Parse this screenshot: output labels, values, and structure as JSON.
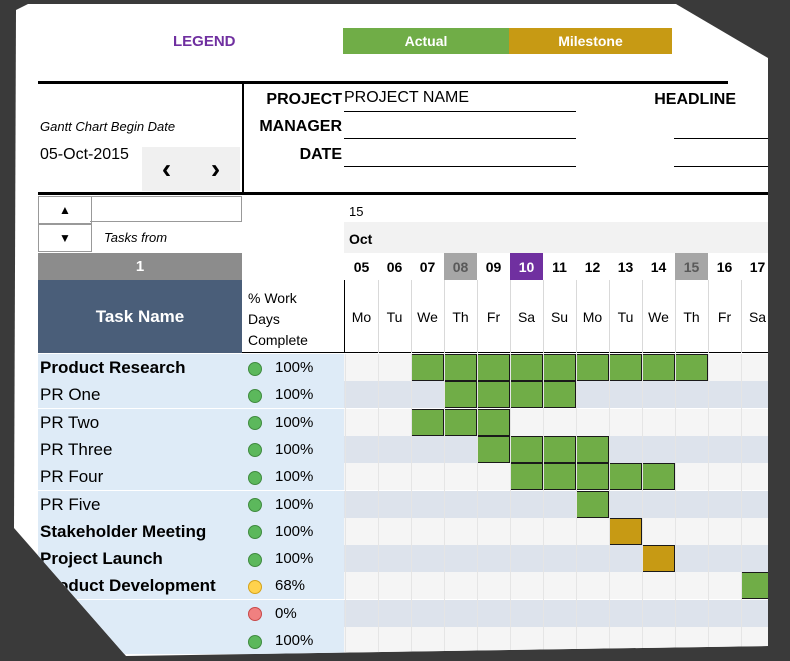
{
  "legend": {
    "title": "LEGEND",
    "actual": "Actual",
    "milestone": "Milestone"
  },
  "header": {
    "project_label": "PROJECT",
    "project_value": "PROJECT NAME",
    "manager_label": "MANAGER",
    "date_label": "DATE",
    "headline_label": "HEADLINE"
  },
  "begin": {
    "label": "Gantt Chart Begin Date",
    "date": "05-Oct-2015",
    "prev": "‹",
    "next": "›"
  },
  "scroll": {
    "up": "▲",
    "down": "▼",
    "tasks_from": "Tasks from",
    "start_index": "1"
  },
  "columns": {
    "task_name": "Task Name",
    "pct_line1": "% Work",
    "pct_line2": "Days",
    "pct_line3": "Complete"
  },
  "calendar": {
    "year": "15",
    "month": "Oct",
    "days": [
      {
        "num": "05",
        "name": "Mo",
        "type": "normal"
      },
      {
        "num": "06",
        "name": "Tu",
        "type": "normal"
      },
      {
        "num": "07",
        "name": "We",
        "type": "normal"
      },
      {
        "num": "08",
        "name": "Th",
        "type": "weekend"
      },
      {
        "num": "09",
        "name": "Fr",
        "type": "normal"
      },
      {
        "num": "10",
        "name": "Sa",
        "type": "today"
      },
      {
        "num": "11",
        "name": "Su",
        "type": "normal"
      },
      {
        "num": "12",
        "name": "Mo",
        "type": "normal"
      },
      {
        "num": "13",
        "name": "Tu",
        "type": "normal"
      },
      {
        "num": "14",
        "name": "We",
        "type": "normal"
      },
      {
        "num": "15",
        "name": "Th",
        "type": "weekend"
      },
      {
        "num": "16",
        "name": "Fr",
        "type": "normal"
      },
      {
        "num": "17",
        "name": "Sa",
        "type": "normal"
      }
    ]
  },
  "tasks": [
    {
      "name": "Product Research",
      "bold": true,
      "status": "green",
      "pct": "100%",
      "bars": [
        {
          "start": 2,
          "len": 9,
          "kind": "actual"
        }
      ]
    },
    {
      "name": "PR One",
      "bold": false,
      "status": "green",
      "pct": "100%",
      "bars": [
        {
          "start": 3,
          "len": 4,
          "kind": "actual"
        }
      ]
    },
    {
      "name": "PR Two",
      "bold": false,
      "status": "green",
      "pct": "100%",
      "bars": [
        {
          "start": 2,
          "len": 3,
          "kind": "actual"
        }
      ]
    },
    {
      "name": "PR Three",
      "bold": false,
      "status": "green",
      "pct": "100%",
      "bars": [
        {
          "start": 4,
          "len": 4,
          "kind": "actual"
        }
      ]
    },
    {
      "name": "PR Four",
      "bold": false,
      "status": "green",
      "pct": "100%",
      "bars": [
        {
          "start": 5,
          "len": 5,
          "kind": "actual"
        }
      ]
    },
    {
      "name": "PR Five",
      "bold": false,
      "status": "green",
      "pct": "100%",
      "bars": [
        {
          "start": 7,
          "len": 1,
          "kind": "actual"
        }
      ]
    },
    {
      "name": "Stakeholder Meeting",
      "bold": true,
      "status": "green",
      "pct": "100%",
      "bars": [
        {
          "start": 8,
          "len": 1,
          "kind": "milestone"
        }
      ]
    },
    {
      "name": "Project Launch",
      "bold": true,
      "status": "green",
      "pct": "100%",
      "bars": [
        {
          "start": 9,
          "len": 1,
          "kind": "milestone"
        }
      ]
    },
    {
      "name": "Product Development",
      "bold": true,
      "status": "yellow",
      "pct": "68%",
      "bars": [
        {
          "start": 12,
          "len": 1,
          "kind": "actual"
        }
      ]
    },
    {
      "name": "",
      "bold": false,
      "status": "red",
      "pct": "0%",
      "bars": []
    },
    {
      "name": "",
      "bold": false,
      "status": "green",
      "pct": "100%",
      "bars": []
    }
  ],
  "colors": {
    "actual": "#70ad47",
    "milestone": "#c79a14",
    "today": "#7030a0",
    "header_bg": "#4a5e79",
    "row_alt": "#deebf7"
  }
}
